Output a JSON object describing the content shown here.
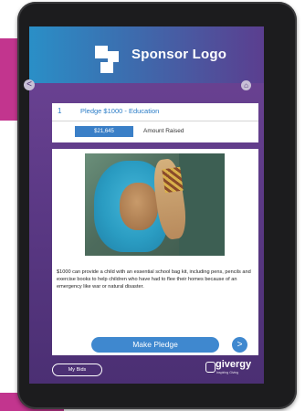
{
  "header": {
    "logo_text": "Sponsor Logo"
  },
  "nav": {
    "back_icon": "chevron-left-icon",
    "back_glyph": "<",
    "home_icon": "home-icon",
    "home_glyph": "⌂"
  },
  "pledge": {
    "number": "1",
    "title": "Pledge $1000 - Education",
    "amount_raised_value": "$21,645",
    "amount_raised_label": "Amount Raised",
    "description": "$1000 can provide a child with an essential school bag kit, including pens, pencils and exercise books to help children who have had to flee their homes because of an emergency like war or natural disaster."
  },
  "actions": {
    "make_pledge_label": "Make Pledge",
    "next_glyph": ">",
    "my_bids_label": "My Bids"
  },
  "brand": {
    "name": "givergy",
    "tagline": "Inspiring Giving"
  },
  "colors": {
    "magenta": "#c2358e",
    "screen_purple": "#5d3a87",
    "header_blue": "#2a8fc7",
    "accent_blue": "#3f88cf"
  }
}
